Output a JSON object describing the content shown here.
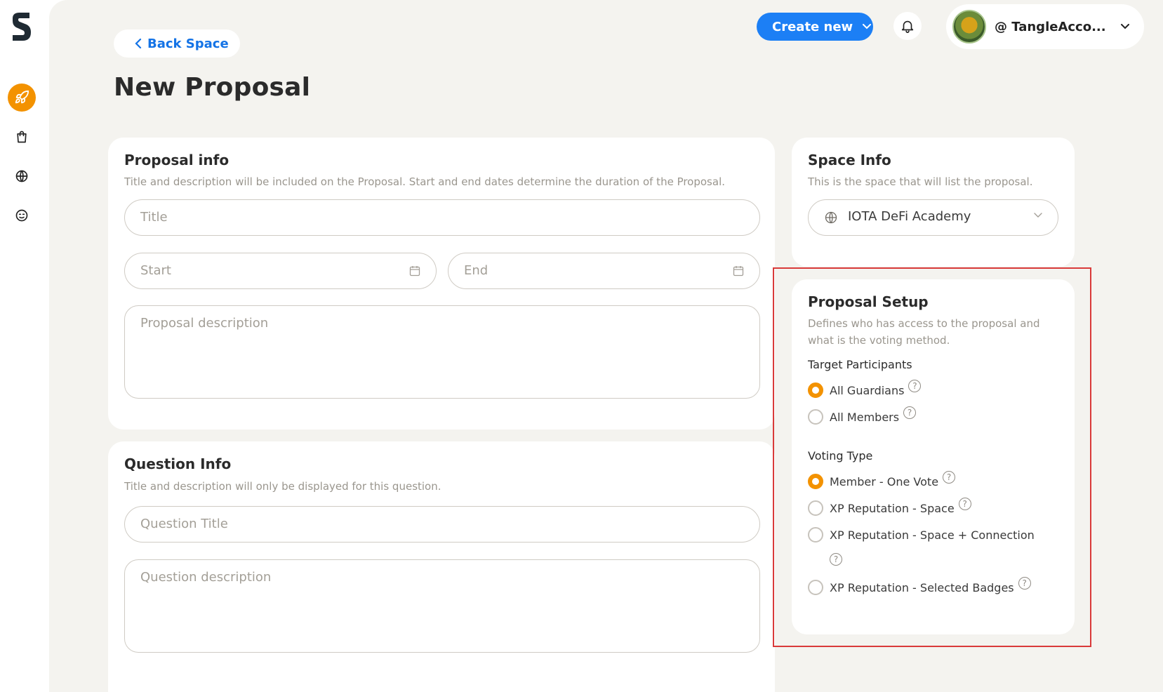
{
  "sidebar": {
    "logo_icon": "soonaverse-s-logo",
    "items": [
      {
        "icon": "rocket-icon",
        "active": true
      },
      {
        "icon": "shopping-bag-icon",
        "active": false
      },
      {
        "icon": "globe-icon",
        "active": false
      },
      {
        "icon": "smiley-icon",
        "active": false
      }
    ],
    "accent": "#f39200"
  },
  "header": {
    "back_label": "Back Space",
    "create_label": "Create new",
    "username": "@ TangleAcco..."
  },
  "page": {
    "title": "New Proposal"
  },
  "proposal_info": {
    "title": "Proposal info",
    "subtitle": "Title and description will be included on the Proposal. Start and end dates determine the duration of the Proposal.",
    "title_placeholder": "Title",
    "start_placeholder": "Start",
    "end_placeholder": "End",
    "description_placeholder": "Proposal description"
  },
  "question_info": {
    "title": "Question Info",
    "subtitle": "Title and description will only be displayed for this question.",
    "title_placeholder": "Question Title",
    "description_placeholder": "Question description"
  },
  "space_info": {
    "title": "Space Info",
    "subtitle": "This is the space that will list the proposal.",
    "selected_space": "IOTA DeFi Academy"
  },
  "proposal_setup": {
    "title": "Proposal Setup",
    "subtitle_line1": "Defines who has access to the proposal and",
    "subtitle_line2": "what is the voting method.",
    "target_label": "Target Participants",
    "target_options": [
      {
        "label": "All Guardians",
        "selected": true
      },
      {
        "label": "All Members",
        "selected": false
      }
    ],
    "voting_label": "Voting Type",
    "voting_options": [
      {
        "label": "Member - One Vote",
        "selected": true
      },
      {
        "label": "XP Reputation - Space",
        "selected": false
      },
      {
        "label": "XP Reputation - Space + Connection",
        "selected": false
      },
      {
        "label": "XP Reputation - Selected Badges",
        "selected": false
      }
    ],
    "help_glyph": "?"
  },
  "colors": {
    "brand_blue": "#1c7ff5",
    "link_blue": "#1473e6",
    "radio_selected": "#f39200",
    "highlight_box": "#d93a3a",
    "page_bg": "#f4f3ef"
  }
}
